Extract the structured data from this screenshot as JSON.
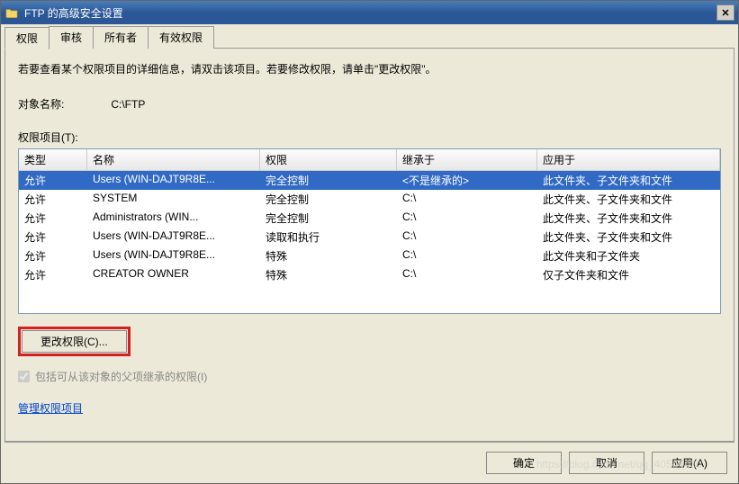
{
  "title": "FTP 的高级安全设置",
  "tabs": [
    "权限",
    "审核",
    "所有者",
    "有效权限"
  ],
  "instruction": "若要查看某个权限项目的详细信息，请双击该项目。若要修改权限，请单击\"更改权限\"。",
  "object_label": "对象名称:",
  "object_value": "C:\\FTP",
  "perms_label": "权限项目(T):",
  "columns": {
    "type": "类型",
    "name": "名称",
    "perm": "权限",
    "inh": "继承于",
    "apply": "应用于"
  },
  "rows": [
    {
      "type": "允许",
      "name": "Users (WIN-DAJT9R8E...",
      "perm": "完全控制",
      "inh": "<不是继承的>",
      "apply": "此文件夹、子文件夹和文件",
      "selected": true
    },
    {
      "type": "允许",
      "name": "SYSTEM",
      "perm": "完全控制",
      "inh": "C:\\",
      "apply": "此文件夹、子文件夹和文件"
    },
    {
      "type": "允许",
      "name": "Administrators (WIN...",
      "perm": "完全控制",
      "inh": "C:\\",
      "apply": "此文件夹、子文件夹和文件"
    },
    {
      "type": "允许",
      "name": "Users (WIN-DAJT9R8E...",
      "perm": "读取和执行",
      "inh": "C:\\",
      "apply": "此文件夹、子文件夹和文件"
    },
    {
      "type": "允许",
      "name": "Users (WIN-DAJT9R8E...",
      "perm": "特殊",
      "inh": "C:\\",
      "apply": "此文件夹和子文件夹"
    },
    {
      "type": "允许",
      "name": "CREATOR OWNER",
      "perm": "特殊",
      "inh": "C:\\",
      "apply": "仅子文件夹和文件"
    }
  ],
  "change_perms_btn": "更改权限(C)...",
  "inherit_chk": "包括可从该对象的父项继承的权限(I)",
  "manage_link": "管理权限项目",
  "footer": {
    "ok": "确定",
    "cancel": "取消",
    "apply": "应用(A)"
  },
  "watermark": "https://blog.csdn.net/qq_40544430"
}
